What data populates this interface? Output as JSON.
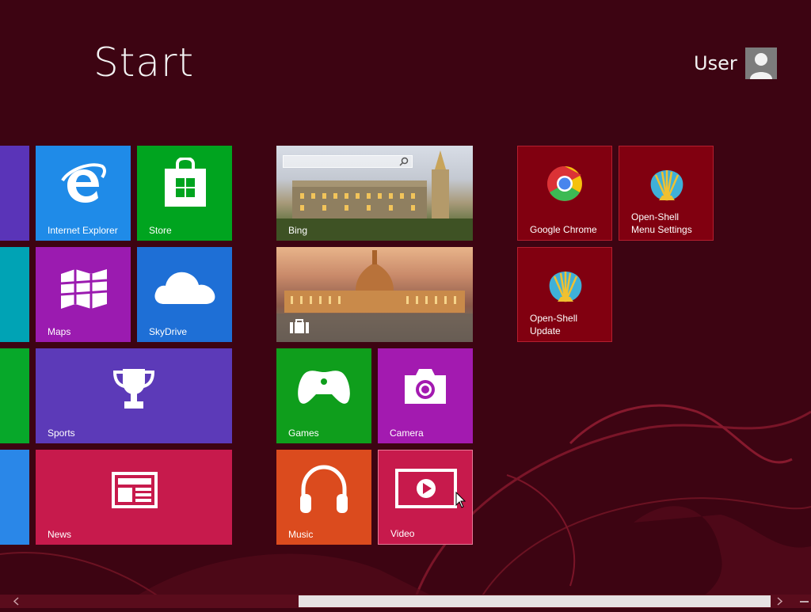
{
  "header": {
    "title": "Start",
    "user_name": "User"
  },
  "colors": {
    "background": "#3d0412",
    "ie": "#1f8be8",
    "store": "#00a41f",
    "maps": "#9b1bb0",
    "skydrive": "#1e6fd6",
    "sports": "#5c3ab8",
    "news": "#c71a4c",
    "games": "#0f9e1c",
    "camera": "#a31ab0",
    "music": "#db4b1e",
    "video": "#c71a4c",
    "desktop_tile": "#810010"
  },
  "tiles": {
    "internet_explorer": {
      "label": "Internet Explorer",
      "icon": "internet-explorer-icon"
    },
    "store": {
      "label": "Store",
      "icon": "store-bag-icon"
    },
    "maps": {
      "label": "Maps",
      "icon": "map-icon"
    },
    "skydrive": {
      "label": "SkyDrive",
      "icon": "cloud-icon"
    },
    "sports": {
      "label": "Sports",
      "icon": "trophy-icon"
    },
    "news": {
      "label": "News",
      "icon": "newspaper-icon"
    },
    "bing": {
      "label": "Bing",
      "icon": "search-icon"
    },
    "travel": {
      "label": "",
      "icon": "suitcase-icon"
    },
    "games": {
      "label": "Games",
      "icon": "gamepad-icon"
    },
    "camera": {
      "label": "Camera",
      "icon": "camera-icon"
    },
    "music": {
      "label": "Music",
      "icon": "headphones-icon"
    },
    "video": {
      "label": "Video",
      "icon": "play-icon"
    },
    "google_chrome": {
      "label": "Google Chrome",
      "icon": "chrome-icon"
    },
    "open_shell_settings": {
      "label_line1": "Open-Shell",
      "label_line2": "Menu Settings",
      "icon": "shell-icon"
    },
    "open_shell_update": {
      "label_line1": "Open-Shell",
      "label_line2": "Update",
      "icon": "shell-icon"
    }
  },
  "scrollbar": {
    "left_arrow": "<",
    "right_arrow": ">",
    "zoom": "−"
  }
}
